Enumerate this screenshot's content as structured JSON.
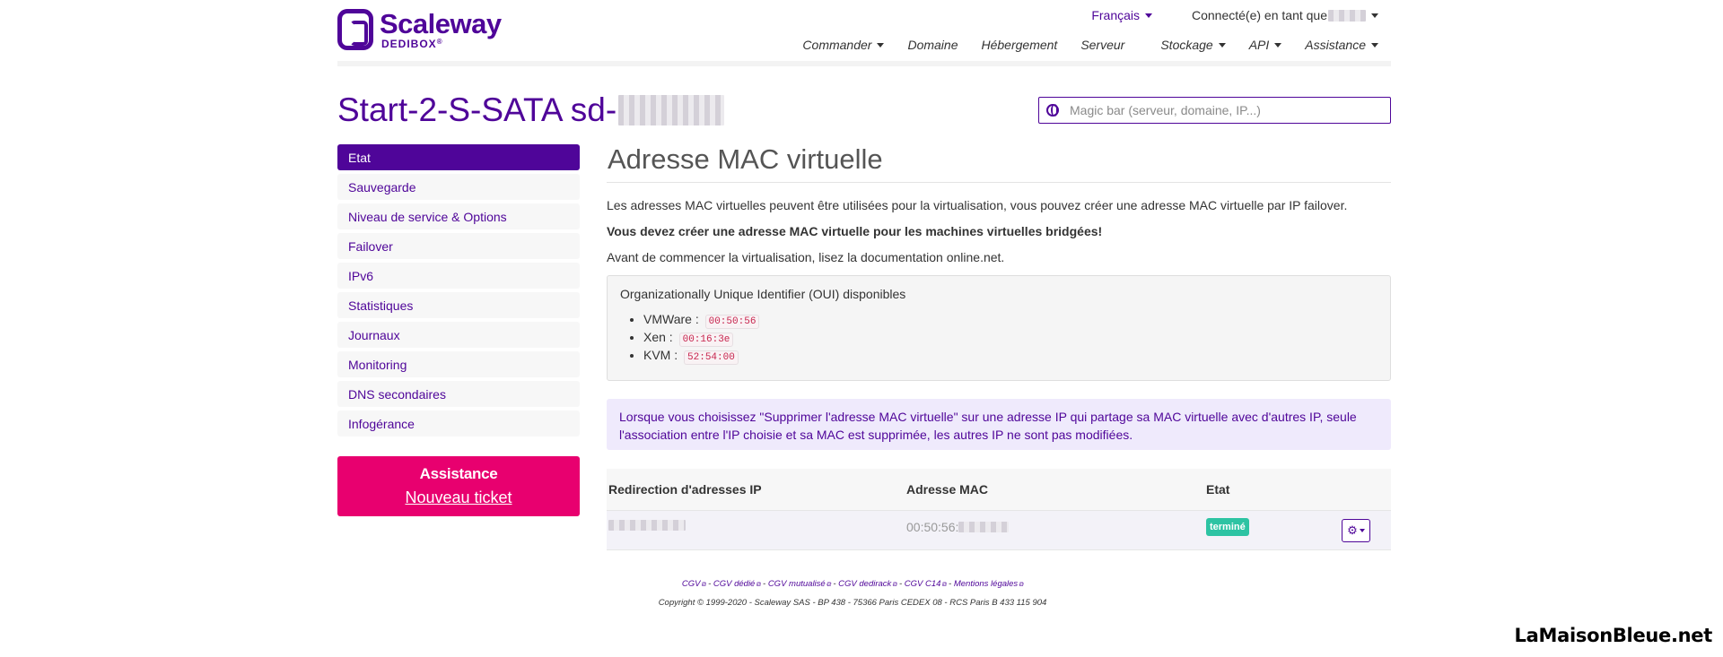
{
  "brand": {
    "name": "Scaleway",
    "sub": "DEDIBOX",
    "registered": "®"
  },
  "topnav": {
    "language": "Français",
    "user_label": "Connecté(e) en tant que"
  },
  "mainnav": [
    {
      "label": "Commander",
      "dropdown": true
    },
    {
      "label": "Domaine",
      "dropdown": false
    },
    {
      "label": "Hébergement",
      "dropdown": false
    },
    {
      "label": "Serveur",
      "dropdown": false
    },
    {
      "label": "Stockage",
      "dropdown": true
    },
    {
      "label": "API",
      "dropdown": true
    },
    {
      "label": "Assistance",
      "dropdown": true
    }
  ],
  "page": {
    "title_prefix": "Start-2-S-SATA sd-"
  },
  "search": {
    "placeholder": "Magic bar (serveur, domaine, IP...)"
  },
  "sidebar": {
    "items": [
      {
        "label": "Etat",
        "active": true
      },
      {
        "label": "Sauvegarde"
      },
      {
        "label": "Niveau de service & Options"
      },
      {
        "label": "Failover"
      },
      {
        "label": "IPv6"
      },
      {
        "label": "Statistiques"
      },
      {
        "label": "Journaux"
      },
      {
        "label": "Monitoring"
      },
      {
        "label": "DNS secondaires"
      },
      {
        "label": "Infogérance"
      }
    ]
  },
  "assist": {
    "title": "Assistance",
    "link": "Nouveau ticket"
  },
  "content": {
    "heading": "Adresse MAC virtuelle",
    "intro": "Les adresses MAC virtuelles peuvent être utilisées pour la virtualisation, vous pouvez créer une adresse MAC virtuelle par IP failover.",
    "warning": "Vous devez créer une adresse MAC virtuelle pour les machines virtuelles bridgées!",
    "doc": "Avant de commencer la virtualisation, lisez la documentation online.net.",
    "oui": {
      "title": "Organizationally Unique Identifier (OUI) disponibles",
      "items": [
        {
          "name": "VMWare :",
          "code": "00:50:56"
        },
        {
          "name": "Xen :",
          "code": "00:16:3e"
        },
        {
          "name": "KVM :",
          "code": "52:54:00"
        }
      ]
    },
    "alert": "Lorsque vous choisissez \"Supprimer l'adresse MAC virtuelle\" sur une adresse IP qui partage sa MAC virtuelle avec d'autres IP, seule l'association entre l'IP choisie et sa MAC est supprimée, les autres IP ne sont pas modifiées.",
    "table": {
      "headers": [
        "Redirection d'adresses IP",
        "Adresse MAC",
        "Etat"
      ],
      "row": {
        "mac_prefix": "00:50:56:",
        "status": "terminé"
      }
    }
  },
  "footer": {
    "links": [
      "CGV",
      "CGV dédié",
      "CGV mutualisé",
      "CGV dedirack",
      "CGV C14",
      "Mentions légales"
    ],
    "copyright": "Copyright © 1999-2020 - Scaleway SAS - BP 438 - 75366 Paris CEDEX 08 - RCS Paris B 433 115 904"
  },
  "watermark": "LaMaisonBleue.net",
  "colors": {
    "brand": "#4f0599",
    "assist": "#e8006f",
    "status": "#2dc3a3"
  }
}
